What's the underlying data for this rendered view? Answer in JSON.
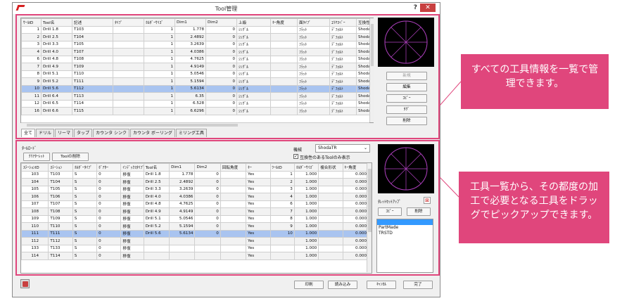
{
  "window": {
    "title": "Tool管理",
    "help_label": "?",
    "close_label": "✕"
  },
  "top_table": {
    "headers": [
      "ｻｰﾙID",
      "Tool名",
      "記述",
      "ﾀｲﾌﾟ",
      "ﾎﾙﾀﾞｰｻｲｽﾞ",
      "Dim1",
      "Dim2",
      "上級",
      "ｷｰ角度",
      "面ﾀｲﾌﾟ",
      "ｴﾘﾔｽﾍﾟｰ",
      "互換性"
    ],
    "rows": [
      [
        "1",
        "Drill 1.8",
        "T103",
        "",
        "1",
        "1.778",
        "0",
        "ｼﾝｸﾞﾙ",
        "",
        "ﾌﾗｯﾄ",
        "ﾃﾞﾌｫﾙﾄ",
        "Shoda"
      ],
      [
        "2",
        "Drill 2.5",
        "T104",
        "",
        "1",
        "2.4892",
        "0",
        "ｼﾝｸﾞﾙ",
        "",
        "ﾌﾗｯﾄ",
        "ﾃﾞﾌｫﾙﾄ",
        "Shoda"
      ],
      [
        "3",
        "Drill 3.3",
        "T105",
        "",
        "1",
        "3.2639",
        "0",
        "ｼﾝｸﾞﾙ",
        "",
        "ﾌﾗｯﾄ",
        "ﾃﾞﾌｫﾙﾄ",
        "Shoda"
      ],
      [
        "4",
        "Drill 4.0",
        "T107",
        "",
        "1",
        "4.0386",
        "0",
        "ｼﾝｸﾞﾙ",
        "",
        "ﾌﾗｯﾄ",
        "ﾃﾞﾌｫﾙﾄ",
        "Shoda"
      ],
      [
        "6",
        "Drill 4.8",
        "T108",
        "",
        "1",
        "4.7625",
        "0",
        "ｼﾝｸﾞﾙ",
        "",
        "ﾌﾗｯﾄ",
        "ﾃﾞﾌｫﾙﾄ",
        "Shoda"
      ],
      [
        "7",
        "Drill 4.9",
        "T109",
        "",
        "1",
        "4.9149",
        "0",
        "ｼﾝｸﾞﾙ",
        "",
        "ﾌﾗｯﾄ",
        "ﾃﾞﾌｫﾙﾄ",
        "Shoda"
      ],
      [
        "8",
        "Drill 5.1",
        "T110",
        "",
        "1",
        "5.0546",
        "0",
        "ｼﾝｸﾞﾙ",
        "",
        "ﾌﾗｯﾄ",
        "ﾃﾞﾌｫﾙﾄ",
        "Shoda"
      ],
      [
        "9",
        "Drill 5.2",
        "T111",
        "",
        "1",
        "5.1594",
        "0",
        "ｼﾝｸﾞﾙ",
        "",
        "ﾌﾗｯﾄ",
        "ﾃﾞﾌｫﾙﾄ",
        "Shoda"
      ],
      [
        "10",
        "Drill 5.6",
        "T112",
        "",
        "1",
        "5.6134",
        "0",
        "ｼﾝｸﾞﾙ",
        "",
        "ﾌﾗｯﾄ",
        "ﾃﾞﾌｫﾙﾄ",
        "Shoda"
      ],
      [
        "11",
        "Drill 6.4",
        "T113",
        "",
        "1",
        "6.35",
        "0",
        "ｼﾝｸﾞﾙ",
        "",
        "ﾌﾗｯﾄ",
        "ﾃﾞﾌｫﾙﾄ",
        "Shoda"
      ],
      [
        "12",
        "Drill 6.5",
        "T114",
        "",
        "1",
        "6.528",
        "0",
        "ｼﾝｸﾞﾙ",
        "",
        "ﾌﾗｯﾄ",
        "ﾃﾞﾌｫﾙﾄ",
        "Shoda"
      ],
      [
        "16",
        "Drill 6.6",
        "T115",
        "",
        "1",
        "6.6296",
        "0",
        "ｼﾝｸﾞﾙ",
        "",
        "ﾌﾗｯﾄ",
        "ﾃﾞﾌｫﾙﾄ",
        "Shoda"
      ]
    ],
    "selected_row": 8
  },
  "top_buttons": {
    "new": "新規",
    "edit": "編集",
    "copy": "ｺﾋﾟｰ",
    "tag": "ﾀｸﾞ",
    "delete": "削除"
  },
  "tabs": [
    "全て",
    "ドリル",
    "リーマ",
    "タップ",
    "カウンタ シンク",
    "カウンタ ボーリング",
    "ミリング工具"
  ],
  "bottom": {
    "section_label": "ﾀｰﾙﾛｰﾄﾞ",
    "clear_button": "ｸﾘｱﾀｰﾚｯﾄ",
    "tool_delete_button": "Toolの削除",
    "machine_label": "機械",
    "machine_value": "ShodaTR",
    "compat_checkbox_label": "互換性のあるToolのみ表示",
    "compat_checked": true,
    "headers": [
      "ｽﾃｰｼｮﾝID",
      "ｽﾃｰｼｮﾝ",
      "ﾎﾙﾀﾞｰﾀｲﾌﾟ",
      "ﾎﾞｱﾀｰ",
      "ｲﾝﾃﾞｯｸｽﾀｲﾌﾟ",
      "Tool名",
      "Dim1",
      "Dim2",
      "回転角度",
      "ｷｰ",
      "ﾂｰﾙID",
      "ﾎﾙﾀﾞｰｻｲｽﾞ",
      "複合形状",
      "ｷｰ角度"
    ],
    "rows": [
      [
        "103",
        "T103",
        "S",
        "0",
        "移復",
        "Drill 1.8",
        "1.778",
        "0",
        "",
        "Yes",
        "1",
        "1.000",
        "",
        "0.000"
      ],
      [
        "104",
        "T104",
        "S",
        "0",
        "移復",
        "Drill 2.5",
        "2.4892",
        "0",
        "",
        "Yes",
        "2",
        "1.000",
        "",
        "0.000"
      ],
      [
        "105",
        "T105",
        "S",
        "0",
        "移復",
        "Drill 3.3",
        "3.2639",
        "0",
        "",
        "Yes",
        "3",
        "1.000",
        "",
        "0.000"
      ],
      [
        "106",
        "T106",
        "S",
        "0",
        "移復",
        "Drill 4.0",
        "4.0386",
        "0",
        "",
        "Yes",
        "4",
        "1.000",
        "",
        "0.000"
      ],
      [
        "107",
        "T107",
        "S",
        "0",
        "移復",
        "Drill 4.8",
        "4.7625",
        "0",
        "",
        "Yes",
        "6",
        "1.000",
        "",
        "0.000"
      ],
      [
        "108",
        "T108",
        "S",
        "0",
        "移復",
        "Drill 4.9",
        "4.9149",
        "0",
        "",
        "Yes",
        "7",
        "1.000",
        "",
        "0.000"
      ],
      [
        "109",
        "T109",
        "S",
        "0",
        "移復",
        "Drill 5.1",
        "5.0546",
        "0",
        "",
        "Yes",
        "8",
        "1.000",
        "",
        "0.000"
      ],
      [
        "110",
        "T110",
        "S",
        "0",
        "移復",
        "Drill 5.2",
        "5.1594",
        "0",
        "",
        "Yes",
        "9",
        "1.000",
        "",
        "0.000"
      ],
      [
        "111",
        "T111",
        "S",
        "0",
        "移復",
        "Drill 5.6",
        "5.6134",
        "0",
        "",
        "Yes",
        "10",
        "1.000",
        "",
        "0.000"
      ],
      [
        "112",
        "T112",
        "S",
        "0",
        "移復",
        "",
        "",
        "",
        "",
        "Yes",
        "",
        "1.000",
        "",
        "0.000"
      ],
      [
        "133",
        "T133",
        "S",
        "0",
        "移復",
        "",
        "",
        "",
        "",
        "Yes",
        "",
        "1.000",
        "",
        "0.000"
      ],
      [
        "114",
        "T114",
        "S",
        "0",
        "移復",
        "",
        "",
        "",
        "",
        "Yes",
        "",
        "1.000",
        "",
        "0.000"
      ]
    ],
    "selected_row": 8,
    "turret_label": "ﾀﾚｯﾄｾｯﾄｱｯﾌﾟ",
    "turret_copy": "ｺﾋﾟｰ",
    "turret_delete": "削除",
    "turret_items": [
      "",
      "PartMade",
      "TRSTD"
    ]
  },
  "footer": {
    "print": "印刷",
    "load": "読み込み",
    "cancel": "ｷｬﾝｾﾙ",
    "done": "完了"
  },
  "callouts": {
    "top": "すべての工具情報を一覧で管理できます。",
    "bottom": "工具一覧から、その都度の加工で必要となる工具をドラッグでピックアップできます。"
  },
  "colors": {
    "accent": "#e0467c",
    "selection": "#a9c4f0",
    "preview_bg": "#000000",
    "preview_line": "#b040c0"
  }
}
